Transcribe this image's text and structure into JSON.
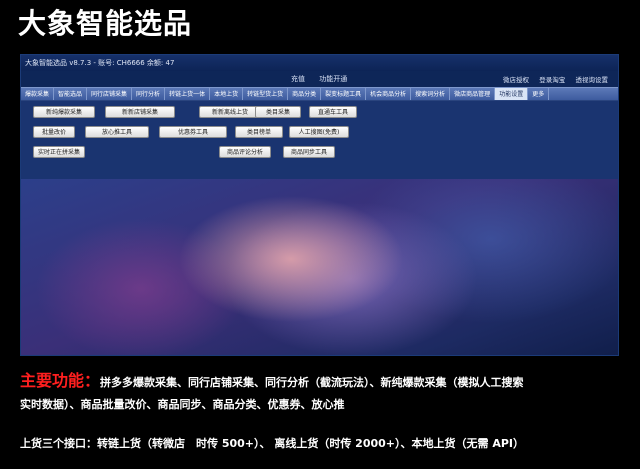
{
  "heading": "大象智能选品",
  "app": {
    "title": "大象智能选品 v8.7.3 - 账号: CH6666 余额: 47",
    "top_center": [
      "充值",
      "功能开通"
    ],
    "top_right": [
      "微店授权",
      "登录淘宝",
      "透视询设置"
    ],
    "tabs": [
      "爆款采集",
      "智能选品",
      "同行店铺采集",
      "同行分析",
      "转链上货一体",
      "本地上货",
      "转链型货上货",
      "商品分类",
      "裂变标题工具",
      "机会商品分析",
      "搜索词分析",
      "微店商品管理",
      "功能设置",
      "更多"
    ],
    "tools": [
      "新纯爆款采集",
      "新新店铺采集",
      "新新离线上货",
      "类目采集",
      "直通车工具",
      "批量改价",
      "放心推工具",
      "优惠券工具",
      "类目榜单",
      "人工搜图(免费)",
      "实时正在拼采集",
      "商品评论分析",
      "商品同步工具"
    ]
  },
  "features": {
    "label": "主要功能：",
    "line1": "拼多多爆款采集、同行店铺采集、同行分析（截流玩法）、新纯爆款采集（模拟人工搜索",
    "line2": "实时数据）、商品批量改价、商品同步、商品分类、优惠券、放心推"
  },
  "interfaces": "上货三个接口：转链上货（转微店　时传 500+）、 离线上货（时传 2000+）、本地上货（无需 API）"
}
